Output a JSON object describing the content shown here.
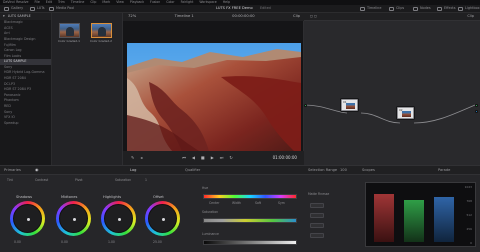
{
  "menu": [
    "DaVinci Resolve",
    "File",
    "Edit",
    "Trim",
    "Timeline",
    "Clip",
    "Mark",
    "View",
    "Playback",
    "Fusion",
    "Color",
    "Fairlight",
    "Workspace",
    "Help"
  ],
  "toolbar": {
    "left": [
      "Gallery",
      "LUTs",
      "Media Pool"
    ],
    "center_title": "LUTS FX FREE Demo",
    "center_status": "Edited",
    "right": [
      "Timeline",
      "Clips",
      "Nodes",
      "Effects",
      "Lightbox"
    ]
  },
  "gallery": {
    "title": "LUTS SAMPLE",
    "items": [
      "Blackmagic",
      "ACES",
      "Arri",
      "Blackmagic Design",
      "Fujifilm",
      "Canon Log",
      "Film Looks",
      "LUTS SAMPLE",
      "Sony",
      "HDR Hybrid Log-Gamma",
      "HDR ST 2084",
      "DCI-P3",
      "HDR ST 2084 P3",
      "Panasonic",
      "Phantom",
      "RED",
      "Sony",
      "VFX IO",
      "Speedup"
    ]
  },
  "clips": [
    {
      "label": "Color Graded-1"
    },
    {
      "label": "Color Graded-2"
    }
  ],
  "viewer": {
    "zoom": "72%",
    "timeline": "Timeline 1",
    "timecode": "00:00:00:00",
    "clip": "Clip",
    "bottom_timecode": "01:00:00:00"
  },
  "nodes": {
    "title": "Clip",
    "node1": "01",
    "node2": "02"
  },
  "bottom_bar": {
    "primaries": "Primaries",
    "qualifier": "Qualifier",
    "selection": "Selection Range",
    "scopes": "Scopes",
    "parade": "Parade",
    "percent": "100",
    "log": "Log",
    "frame": "1",
    "tint": "Tint",
    "contrast": "Contrast",
    "pivot": "Pivot",
    "saturation": "Saturation"
  },
  "wheels": [
    {
      "name": "Shadows",
      "value": "0.00"
    },
    {
      "name": "Midtones",
      "value": "0.00"
    },
    {
      "name": "Highlights",
      "value": "1.00"
    },
    {
      "name": "Offset",
      "value": "25.00"
    }
  ],
  "qualifier": {
    "hue": "Hue",
    "saturation": "Saturation",
    "luminance": "Luminance",
    "labels": [
      "Center",
      "Width",
      "Soft",
      "Sym"
    ],
    "matte": "Matte Finesse"
  },
  "scope_numbers": [
    "1023",
    "768",
    "512",
    "256",
    "0"
  ],
  "colors": {
    "accent": "#d98f3a",
    "node_green": "#3bd56a",
    "node_blue": "#2d95e8"
  }
}
